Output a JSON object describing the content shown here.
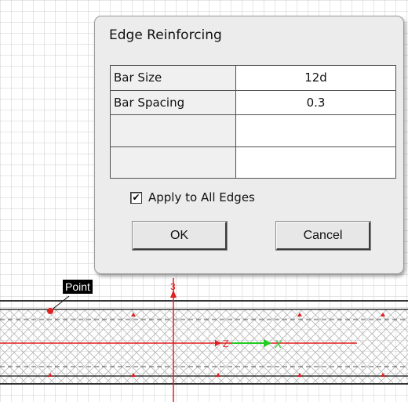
{
  "dialog": {
    "title": "Edge Reinforcing",
    "rows": [
      {
        "label": "Bar Size",
        "value": "12d"
      },
      {
        "label": "Bar Spacing",
        "value": "0.3"
      },
      {
        "label": "",
        "value": ""
      },
      {
        "label": "",
        "value": ""
      }
    ],
    "apply_all_label": "Apply to All Edges",
    "apply_all_checked": true,
    "ok_label": "OK",
    "cancel_label": "Cancel"
  },
  "canvas": {
    "point_label": "Point",
    "axis_y_label": "3",
    "axis_z_label": "Z",
    "axis_x_label": "X",
    "colors": {
      "grid": "#c9c9c9",
      "structure_line": "#333333",
      "axis_red": "#e02020",
      "axis_green": "#22cc22",
      "point": "#e02020"
    }
  }
}
